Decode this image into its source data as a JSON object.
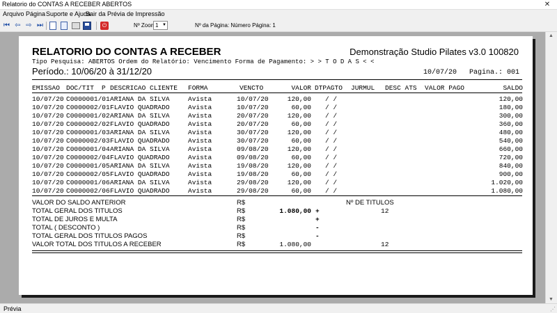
{
  "window": {
    "title": "Relatorio do CONTAS A RECEBER ABERTOS",
    "close_glyph": "✕"
  },
  "menu": {
    "items": [
      "Arquivo",
      "Página",
      "Suporte e Ajuda",
      "Sair da Prévia de Impressão"
    ]
  },
  "toolbar": {
    "zoom_label": "Nº Zoom",
    "zoom_value": "1",
    "page_label": "Nº da Página: Número Página: 1"
  },
  "report": {
    "title": "RELATORIO DO CONTAS A RECEBER",
    "company": "Demonstração Studio Pilates v3.0 100820",
    "filter_line": "Tipo Pesquisa: ABERTOS   Ordem do Relatório: Vencimento  Forma de Pagamento: > > T O D A S < <",
    "period": "Período.: 10/06/20 à 31/12/20",
    "date": "10/07/20",
    "page": "Pagina.: 001",
    "columns": {
      "emissao": "EMISSAO",
      "doc": "DOC/TIT",
      "p": "P",
      "descricao": "DESCRICAO CLIENTE",
      "forma": "FORMA",
      "vencto": "VENCTO",
      "valor": "VALOR",
      "dtpagto": "DTPAGTO",
      "jurmul": "JURMUL",
      "desc_ats": "DESC ATS",
      "valor_pago": "VALOR PAGO",
      "saldo": "SALDO"
    },
    "rows": [
      {
        "emissao": "10/07/20",
        "doc": "C0000001/01",
        "cliente": "ARIANA DA SILVA",
        "forma": "Avista",
        "vencto": "10/07/20",
        "valor": "120,00",
        "dtpagto": "/  /",
        "saldo": "120,00"
      },
      {
        "emissao": "10/07/20",
        "doc": "C0000002/01",
        "cliente": "FLAVIO QUADRADO",
        "forma": "Avista",
        "vencto": "10/07/20",
        "valor": "60,00",
        "dtpagto": "/  /",
        "saldo": "180,00"
      },
      {
        "emissao": "10/07/20",
        "doc": "C0000001/02",
        "cliente": "ARIANA DA SILVA",
        "forma": "Avista",
        "vencto": "20/07/20",
        "valor": "120,00",
        "dtpagto": "/  /",
        "saldo": "300,00"
      },
      {
        "emissao": "10/07/20",
        "doc": "C0000002/02",
        "cliente": "FLAVIO QUADRADO",
        "forma": "Avista",
        "vencto": "20/07/20",
        "valor": "60,00",
        "dtpagto": "/  /",
        "saldo": "360,00"
      },
      {
        "emissao": "10/07/20",
        "doc": "C0000001/03",
        "cliente": "ARIANA DA SILVA",
        "forma": "Avista",
        "vencto": "30/07/20",
        "valor": "120,00",
        "dtpagto": "/  /",
        "saldo": "480,00"
      },
      {
        "emissao": "10/07/20",
        "doc": "C0000002/03",
        "cliente": "FLAVIO QUADRADO",
        "forma": "Avista",
        "vencto": "30/07/20",
        "valor": "60,00",
        "dtpagto": "/  /",
        "saldo": "540,00"
      },
      {
        "emissao": "10/07/20",
        "doc": "C0000001/04",
        "cliente": "ARIANA DA SILVA",
        "forma": "Avista",
        "vencto": "09/08/20",
        "valor": "120,00",
        "dtpagto": "/  /",
        "saldo": "660,00"
      },
      {
        "emissao": "10/07/20",
        "doc": "C0000002/04",
        "cliente": "FLAVIO QUADRADO",
        "forma": "Avista",
        "vencto": "09/08/20",
        "valor": "60,00",
        "dtpagto": "/  /",
        "saldo": "720,00"
      },
      {
        "emissao": "10/07/20",
        "doc": "C0000001/05",
        "cliente": "ARIANA DA SILVA",
        "forma": "Avista",
        "vencto": "19/08/20",
        "valor": "120,00",
        "dtpagto": "/  /",
        "saldo": "840,00"
      },
      {
        "emissao": "10/07/20",
        "doc": "C0000002/05",
        "cliente": "FLAVIO QUADRADO",
        "forma": "Avista",
        "vencto": "19/08/20",
        "valor": "60,00",
        "dtpagto": "/  /",
        "saldo": "900,00"
      },
      {
        "emissao": "10/07/20",
        "doc": "C0000001/06",
        "cliente": "ARIANA DA SILVA",
        "forma": "Avista",
        "vencto": "29/08/20",
        "valor": "120,00",
        "dtpagto": "/  /",
        "saldo": "1.020,00"
      },
      {
        "emissao": "10/07/20",
        "doc": "C0000002/06",
        "cliente": "FLAVIO QUADRADO",
        "forma": "Avista",
        "vencto": "29/08/20",
        "valor": "60,00",
        "dtpagto": "/  /",
        "saldo": "1.080,00"
      }
    ],
    "summary": {
      "titles_header": "Nº DE TITULOS",
      "items": [
        {
          "label": "VALOR DO SALDO ANTERIOR",
          "currency": "R$",
          "value": "",
          "sign": "",
          "count": ""
        },
        {
          "label": "TOTAL GERAL DOS TITULOS",
          "currency": "R$",
          "value": "1.080,00",
          "sign": "+",
          "count": "12"
        },
        {
          "label": "TOTAL DE JUROS E MULTA",
          "currency": "R$",
          "value": "",
          "sign": "+",
          "count": ""
        },
        {
          "label": "TOTAL ( DESCONTO )",
          "currency": "R$",
          "value": "",
          "sign": "-",
          "count": ""
        },
        {
          "label": "TOTAL GERAL DOS TITULOS PAGOS",
          "currency": "R$",
          "value": "",
          "sign": "-",
          "count": ""
        },
        {
          "label": "VALOR TOTAL DOS TITULOS A RECEBER",
          "currency": "R$",
          "value": "1.080,00",
          "sign": "",
          "count": "12"
        }
      ]
    }
  },
  "statusbar": {
    "text": "Prévia"
  }
}
